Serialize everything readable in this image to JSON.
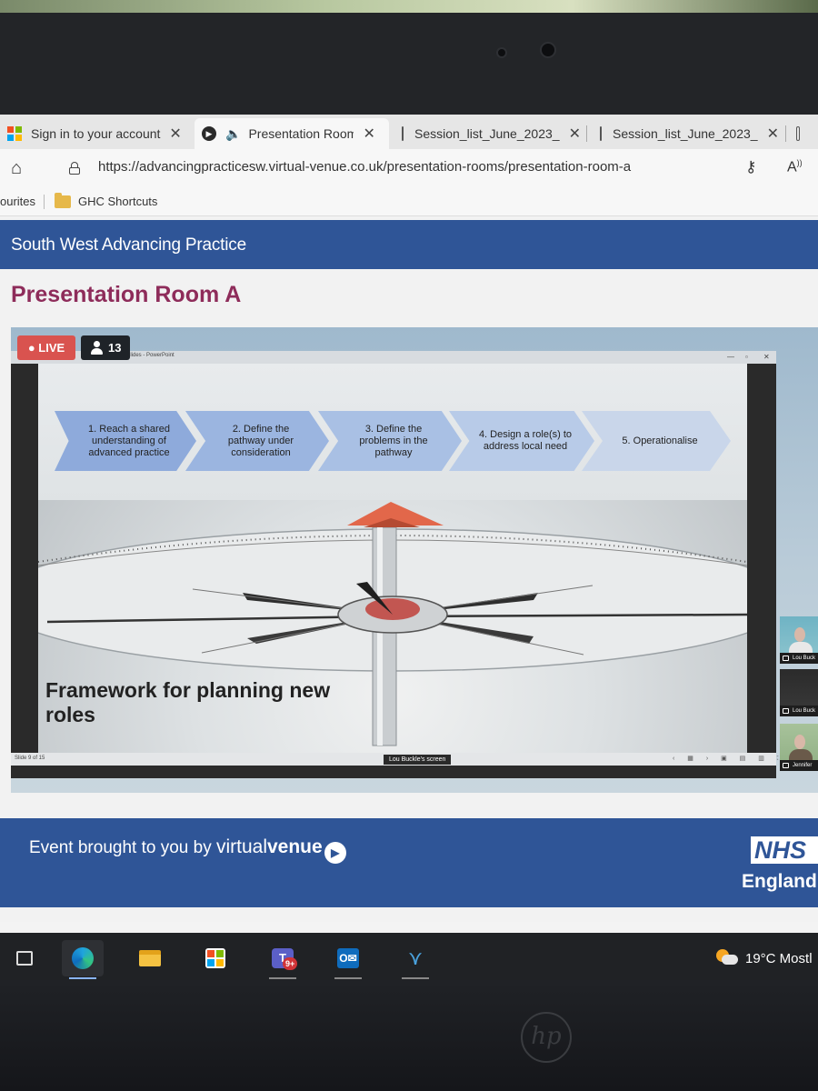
{
  "browser": {
    "tabs": [
      {
        "label": "Sign in to your account",
        "icon": "microsoft-logo"
      },
      {
        "label": "Presentation Room",
        "icon": "virtualvenue-logo"
      },
      {
        "label": "Session_list_June_2023_",
        "icon": "document-icon"
      },
      {
        "label": "Session_list_June_2023_",
        "icon": "document-icon"
      }
    ],
    "close_glyph": "✕",
    "url": "https://advancingpracticesw.virtual-venue.co.uk/presentation-rooms/presentation-room-a",
    "favourites_partial": "ourites",
    "favourites": [
      {
        "label": "GHC Shortcuts",
        "icon": "folder-icon"
      }
    ]
  },
  "site": {
    "header_title": "South West Advancing Practice",
    "room_title": "Presentation Room A"
  },
  "player": {
    "live_label": "LIVE",
    "viewer_count": "13",
    "window_title": "ee slides - PowerPoint",
    "steps": [
      "1. Reach a shared understanding of advanced practice",
      "2. Define the pathway under consideration",
      "3. Define the problems in the pathway",
      "4. Design a role(s) to address local need",
      "5. Operationalise"
    ],
    "slide_caption": "Framework for planning new\nroles",
    "slide_counter": "Slide 9 of 15",
    "presenter_label": "Lou Buckle's screen",
    "participants": [
      {
        "name": "Lou Buck"
      },
      {
        "name": "Lou Buck"
      },
      {
        "name": "Jennifer"
      }
    ]
  },
  "footer": {
    "text": "Event brought to you by",
    "brand_regular": "virtual",
    "brand_bold": "venue",
    "nhs": "NHS",
    "region": "England"
  },
  "taskbar": {
    "teams_badge": "9+",
    "weather": "19°C  Mostl"
  },
  "colors": {
    "header_blue": "#2f5597",
    "room_title": "#8e2c5a",
    "live_red": "#d9534f",
    "chevron_1": "#8eaadb",
    "chevron_5": "#c9d6ea"
  }
}
